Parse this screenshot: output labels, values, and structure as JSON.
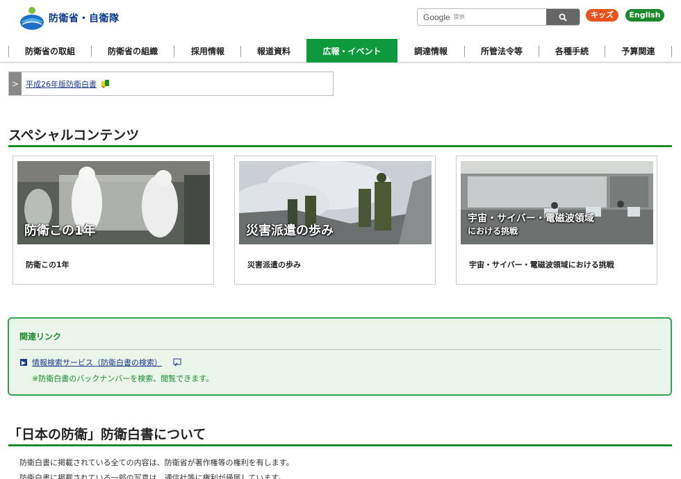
{
  "header": {
    "logo_text": "防衛省・自衛隊",
    "search_brand": "Google",
    "search_provided": "提供",
    "kids_label": "キッズ",
    "english_label": "English"
  },
  "nav": {
    "items": [
      {
        "label": "防衛省の取組"
      },
      {
        "label": "防衛省の組織"
      },
      {
        "label": "採用情報"
      },
      {
        "label": "報道資料"
      },
      {
        "label": "広報・イベント",
        "active": true
      },
      {
        "label": "調達情報"
      },
      {
        "label": "所管法令等"
      },
      {
        "label": "各種手続"
      },
      {
        "label": "予算関連"
      }
    ]
  },
  "whitepaper_link": {
    "chevron": ">",
    "label": "平成26年版防衛白書"
  },
  "special": {
    "title": "スペシャルコンテンツ",
    "cards": [
      {
        "overlay": "防衛この1年",
        "label": "防衛この1年"
      },
      {
        "overlay": "災害派遣の歩み",
        "label": "災害派遣の歩み"
      },
      {
        "overlay_line1": "宇宙・サイバー・電磁波領域",
        "overlay_line2": "における挑戦",
        "label": "宇宙・サイバー・電磁波領域における挑戦"
      }
    ]
  },
  "related": {
    "title": "関連リンク",
    "link_label": "情報検索サービス（防衛白書の検索）",
    "note": "※防衛白書のバックナンバーを検索、閲覧できます。"
  },
  "about": {
    "title": "「日本の防衛」防衛白書について",
    "lines": [
      "防衛白書に掲載されている全ての内容は、防衛省が著作権等の権利を有します。",
      "防衛白書に掲載されている一部の写真は、通信社等に権利が帰属しています。"
    ]
  },
  "colors": {
    "accent_green": "#0d9a3e",
    "kids_orange": "#e9531d",
    "link_blue": "#1a3a8a"
  }
}
